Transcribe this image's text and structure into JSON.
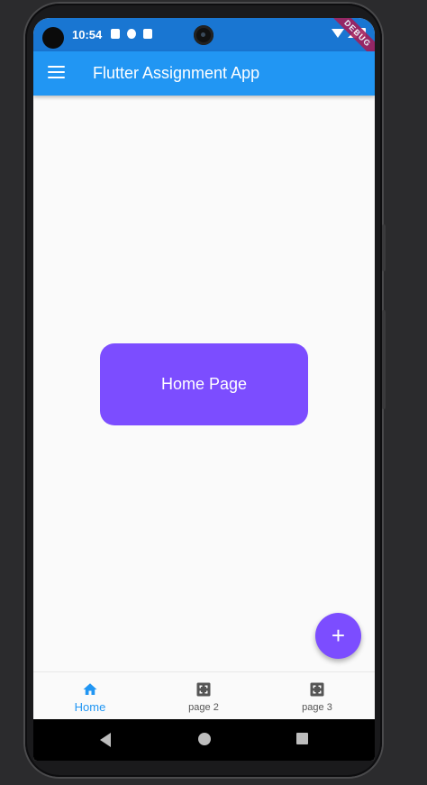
{
  "status_bar": {
    "time": "10:54",
    "debug_label": "DEBUG"
  },
  "app_bar": {
    "title": "Flutter Assignment App",
    "menu_icon": "menu-icon"
  },
  "main": {
    "card_label": "Home Page"
  },
  "fab": {
    "label": "+",
    "icon": "add-icon",
    "color": "#7c4dff"
  },
  "bottom_nav": {
    "items": [
      {
        "label": "Home",
        "icon": "home-icon",
        "active": true
      },
      {
        "label": "page 2",
        "icon": "expand-icon",
        "active": false
      },
      {
        "label": "page 3",
        "icon": "expand-icon",
        "active": false
      }
    ]
  },
  "colors": {
    "primary": "#2196f3",
    "status_bar": "#1976d2",
    "accent": "#7c4dff"
  }
}
